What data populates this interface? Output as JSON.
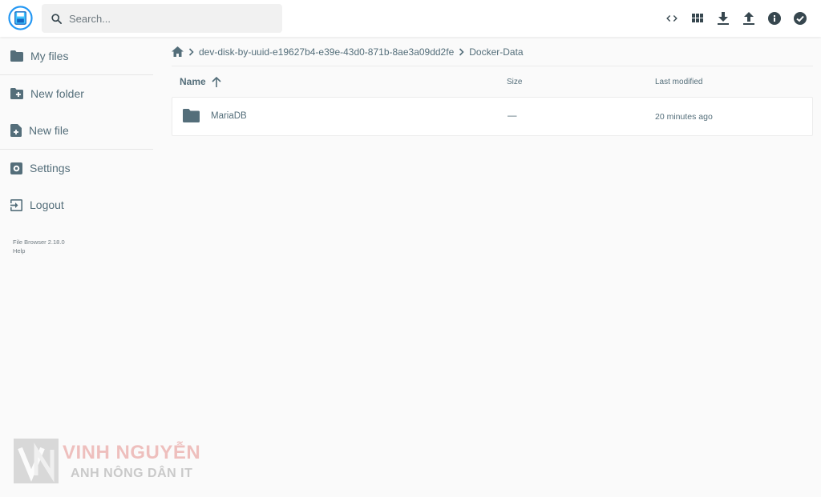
{
  "header": {
    "search_placeholder": "Search...",
    "actions": [
      "code-icon",
      "grid-view-icon",
      "download-icon",
      "upload-icon",
      "info-icon",
      "select-check-icon"
    ]
  },
  "sidebar": {
    "items": [
      {
        "label": "My files",
        "icon": "folder-icon"
      },
      {
        "label": "New folder",
        "icon": "new-folder-icon"
      },
      {
        "label": "New file",
        "icon": "new-file-icon"
      },
      {
        "label": "Settings",
        "icon": "settings-icon"
      },
      {
        "label": "Logout",
        "icon": "logout-icon"
      }
    ],
    "credits": {
      "version": "File Browser 2.18.0",
      "help": "Help"
    }
  },
  "breadcrumb": {
    "home_icon": "home-icon",
    "items": [
      "dev-disk-by-uuid-e19627b4-e39e-43d0-871b-8ae3a09dd2fe",
      "Docker-Data"
    ]
  },
  "listing": {
    "columns": {
      "name": "Name",
      "size": "Size",
      "modified": "Last modified"
    },
    "sort_icon": "arrow-up-icon",
    "rows": [
      {
        "name": "MariaDB",
        "size": "—",
        "modified": "20 minutes ago",
        "icon": "folder-icon"
      }
    ]
  },
  "watermark": {
    "line1": "VINH NGUYỄN",
    "line2": "ANH NÔNG DÂN IT"
  },
  "colors": {
    "accent": "#2196f3",
    "text": "#546e7a",
    "background": "#fafafa"
  }
}
